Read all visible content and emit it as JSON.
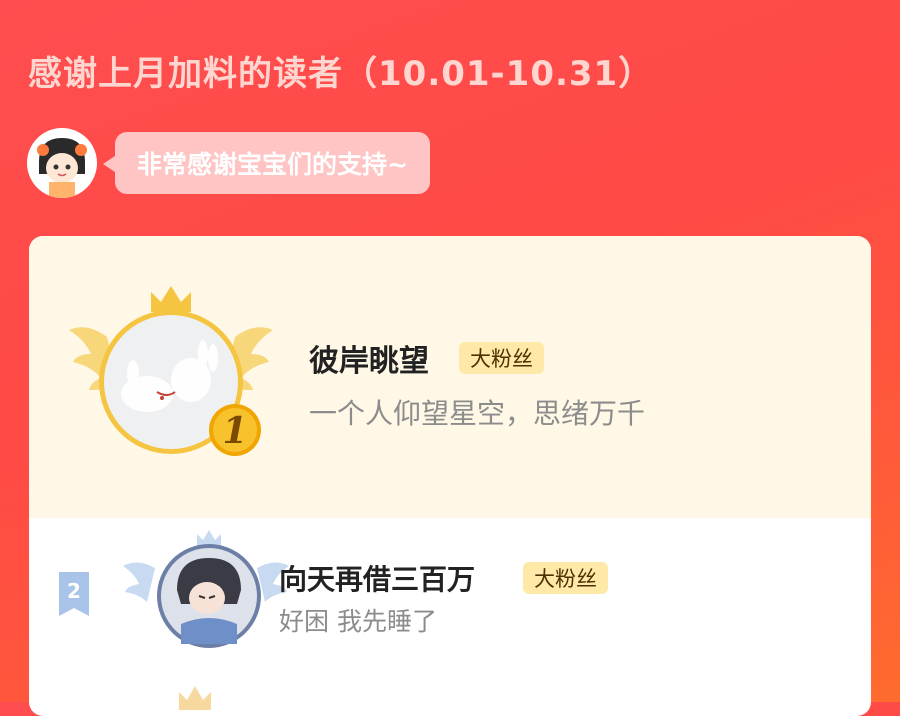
{
  "header": {
    "title": "感谢上月加料的读者（10.01-10.31）"
  },
  "author": {
    "message": "非常感谢宝宝们的支持~"
  },
  "rankings": [
    {
      "rank": "1",
      "name": "彼岸眺望",
      "badge": "大粉丝",
      "motto": "一个人仰望星空，思绪万千"
    },
    {
      "rank": "2",
      "name": "向天再借三百万",
      "badge": "大粉丝",
      "motto": "好困 我先睡了"
    }
  ],
  "colors": {
    "background_start": "#ff4d4f",
    "background_end": "#ff6b2e",
    "top_card_bg": "#fff8e6",
    "badge_bg": "#ffe9a8",
    "gold": "#f5c542"
  }
}
